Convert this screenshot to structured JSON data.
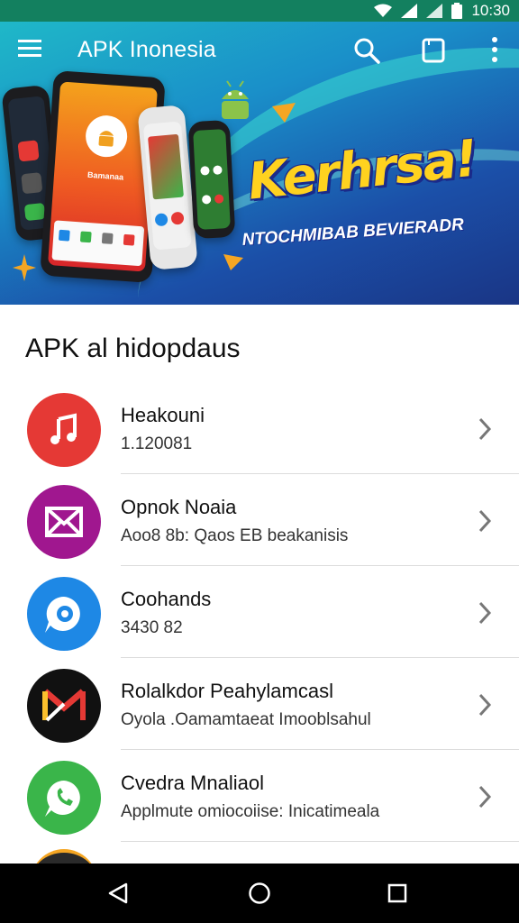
{
  "status_bar": {
    "time": "10:30"
  },
  "app_bar": {
    "title": "APK Inonesia"
  },
  "hero": {
    "headline": "Kerhrsa!",
    "tagline": "NTOCHMIBAB BEVIERADR",
    "phone_text": "Bamanaa"
  },
  "section": {
    "title": "APK al hidopdaus"
  },
  "apps": [
    {
      "name": "Heakouni",
      "subtitle": "1.120081",
      "icon": "music-note-icon",
      "color": "#e53935"
    },
    {
      "name": "Opnok Noaia",
      "subtitle": "Aoo8 8b: Qaos EB beakanisis",
      "icon": "mail-icon",
      "color": "#a0178f"
    },
    {
      "name": "Coohands",
      "subtitle": "3430 82",
      "icon": "chat-bubble-icon",
      "color": "#1e88e5"
    },
    {
      "name": "Rolalkdor Peahylamcasl",
      "subtitle": "Oyola .Oamamtaeat Imooblsahul",
      "icon": "gmail-icon",
      "color": "#111111"
    },
    {
      "name": "Cvedra Mnaliaol",
      "subtitle": "Applmute omiocoiise: Inicatimeala",
      "icon": "whatsapp-icon",
      "color": "#3ab54a"
    }
  ]
}
